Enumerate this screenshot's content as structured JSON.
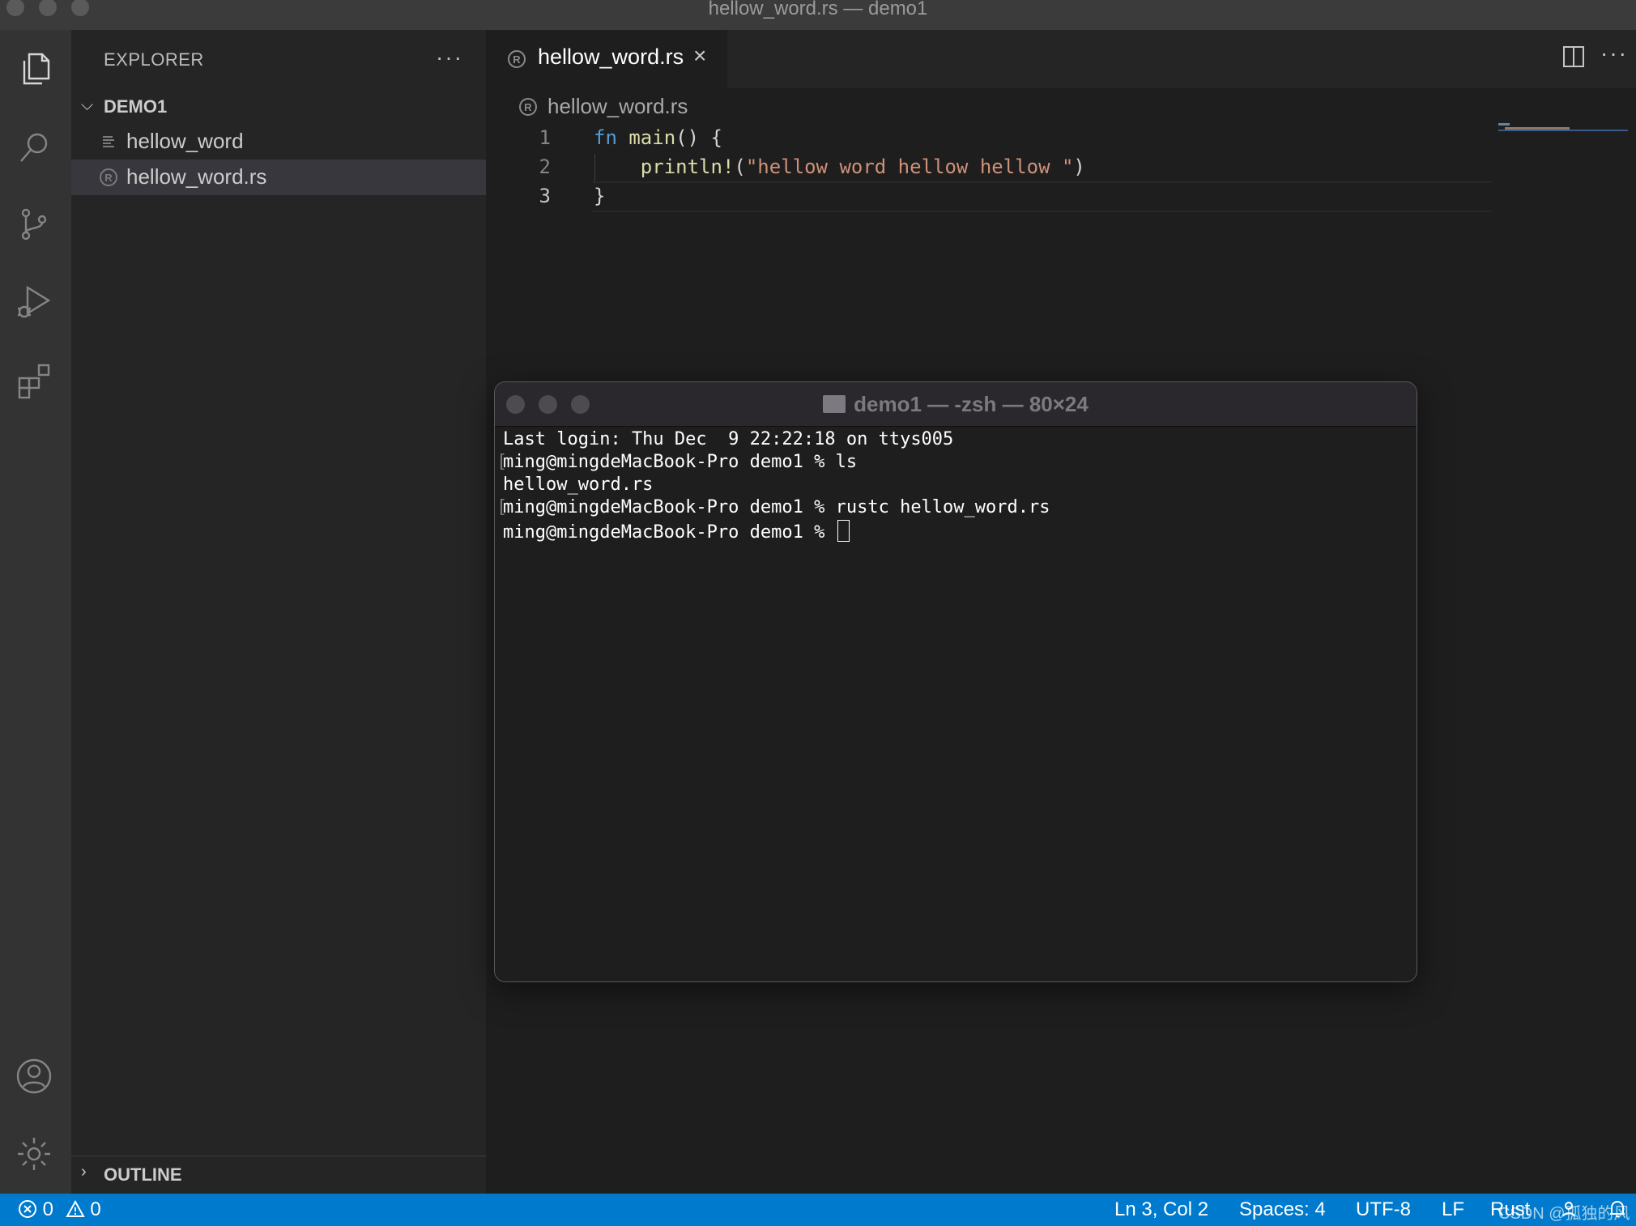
{
  "window": {
    "title": "hellow_word.rs — demo1"
  },
  "sidebar": {
    "header": "EXPLORER",
    "more": "···",
    "folder": "DEMO1",
    "files": [
      {
        "label": "hellow_word",
        "icon": "text-file-icon"
      },
      {
        "label": "hellow_word.rs",
        "icon": "rust-file-icon"
      }
    ],
    "outline": "OUTLINE"
  },
  "editor": {
    "tab_label": "hellow_word.rs",
    "tab_close": "×",
    "more": "···",
    "breadcrumb": "hellow_word.rs",
    "lines": [
      {
        "num": "1",
        "keyword": "fn",
        "fn_name": "main",
        "rest": "() {"
      },
      {
        "num": "2",
        "macro": "println!",
        "open": "(",
        "string": "\"hellow word hellow hellow \"",
        "close": ")"
      },
      {
        "num": "3",
        "text": "}"
      }
    ]
  },
  "terminal": {
    "title": "demo1 — -zsh — 80×24",
    "lines": [
      "Last login: Thu Dec  9 22:22:18 on ttys005",
      "ming@mingdeMacBook-Pro demo1 % ls",
      "hellow_word.rs",
      "ming@mingdeMacBook-Pro demo1 % rustc hellow_word.rs",
      "ming@mingdeMacBook-Pro demo1 % "
    ]
  },
  "statusbar": {
    "errors": "0",
    "warnings": "0",
    "position": "Ln 3, Col 2",
    "spaces": "Spaces: 4",
    "encoding": "UTF-8",
    "eol": "LF",
    "language": "Rust"
  },
  "watermark": "CSDN @孤独的风"
}
